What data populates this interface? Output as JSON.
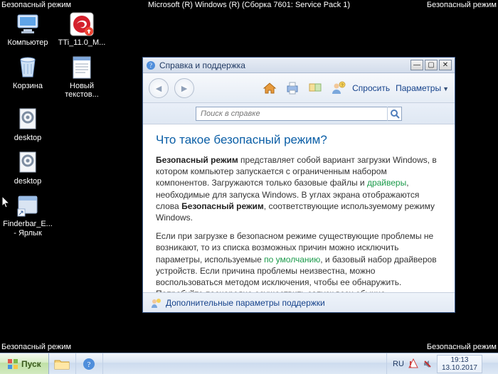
{
  "corners": {
    "top_left": "Безопасный режим",
    "top_right": "Безопасный режим",
    "bottom_left": "Безопасный режим",
    "bottom_right": "Безопасный режим",
    "top_center": "Microsoft (R) Windows (R) (Сборка 7601: Service Pack 1)"
  },
  "desktop": {
    "icons": [
      {
        "label": "Компьютер",
        "glyph": "computer"
      },
      {
        "label": "TTi_11.0_M...",
        "glyph": "trend"
      },
      {
        "label": "Корзина",
        "glyph": "bin"
      },
      {
        "label": "Новый текстов...",
        "glyph": "text"
      },
      {
        "label": "desktop",
        "glyph": "ini"
      },
      {
        "label": "",
        "glyph": ""
      },
      {
        "label": "desktop",
        "glyph": "ini"
      },
      {
        "label": "",
        "glyph": ""
      },
      {
        "label": "Finderbar_E... - Ярлык",
        "glyph": "shortcut"
      }
    ]
  },
  "help_window": {
    "title": "Справка и поддержка",
    "toolbar": {
      "ask_label": "Спросить",
      "options_label": "Параметры"
    },
    "search": {
      "placeholder": "Поиск в справке"
    },
    "content": {
      "heading": "Что такое безопасный режим?",
      "p1_prefix": "Безопасный режим",
      "p1_mid1": " представляет собой вариант загрузки Windows, в котором компьютер запускается с ограниченным набором компонентов. Загружаются только базовые файлы и ",
      "p1_link1": "драйверы",
      "p1_mid2": ", необходимые для запуска Windows. В углах экрана отображаются слова ",
      "p1_bold2": "Безопасный режим",
      "p1_tail": ", соответствующие используемому режиму Windows.",
      "p2_lead": "Если при загрузке в безопасном режиме существующие проблемы не возникают, то из списка возможных причин можно исключить параметры, используемые ",
      "p2_link": "по умолчанию",
      "p2_tail": ", и базовый набор драйверов устройств. Если причина проблемы неизвестна, можно воспользоваться методом исключения, чтобы ее обнаружить. Попробуйте поочередно осуществить запуск всех обычно используемых программ, включая программы из папки «Автозагрузка», чтобы увидеть, какая из программ может приводить к возникновению проблемы."
    },
    "footer": {
      "label": "Дополнительные параметры поддержки"
    }
  },
  "taskbar": {
    "start": "Пуск",
    "tray": {
      "lang": "RU",
      "time": "19:13",
      "date": "13.10.2017"
    }
  }
}
